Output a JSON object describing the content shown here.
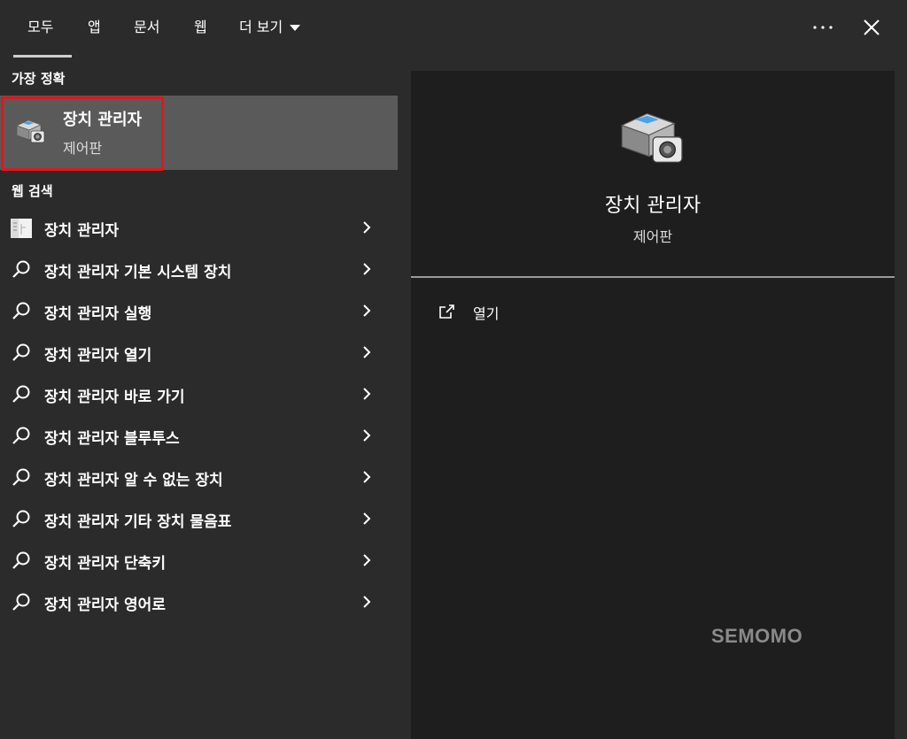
{
  "tabs": [
    {
      "label": "모두",
      "active": true
    },
    {
      "label": "앱"
    },
    {
      "label": "문서"
    },
    {
      "label": "웹"
    },
    {
      "label": "더 보기"
    }
  ],
  "icons": {
    "more": "ellipsis-icon",
    "close": "close-icon",
    "expand": "caret-down-icon",
    "search": "search-icon",
    "chevron": "chevron-right-icon",
    "app": "device-manager-icon",
    "open": "open-icon"
  },
  "best_match": {
    "section_label": "가장 정확",
    "title": "장치 관리자",
    "subtitle": "제어판"
  },
  "web_search": {
    "section_label": "웹 검색",
    "items": [
      {
        "label": "장치 관리자"
      },
      {
        "label": "장치 관리자 기본 시스템 장치"
      },
      {
        "label": "장치 관리자 실행"
      },
      {
        "label": "장치 관리자 열기"
      },
      {
        "label": "장치 관리자 바로 가기"
      },
      {
        "label": "장치 관리자 블루투스"
      },
      {
        "label": "장치 관리자 알 수 없는 장치"
      },
      {
        "label": "장치 관리자 기타 장치 물음표"
      },
      {
        "label": "장치 관리자 단축키"
      },
      {
        "label": "장치 관리자 영어로"
      }
    ]
  },
  "detail": {
    "title": "장치 관리자",
    "subtitle": "제어판",
    "action_label": "열기"
  },
  "watermark": "SEMOMO",
  "colors": {
    "background": "#2b2b2b",
    "detail_panel": "#1e1e1e",
    "selected": "#5a5a5a",
    "highlight_border": "#e0161c"
  }
}
